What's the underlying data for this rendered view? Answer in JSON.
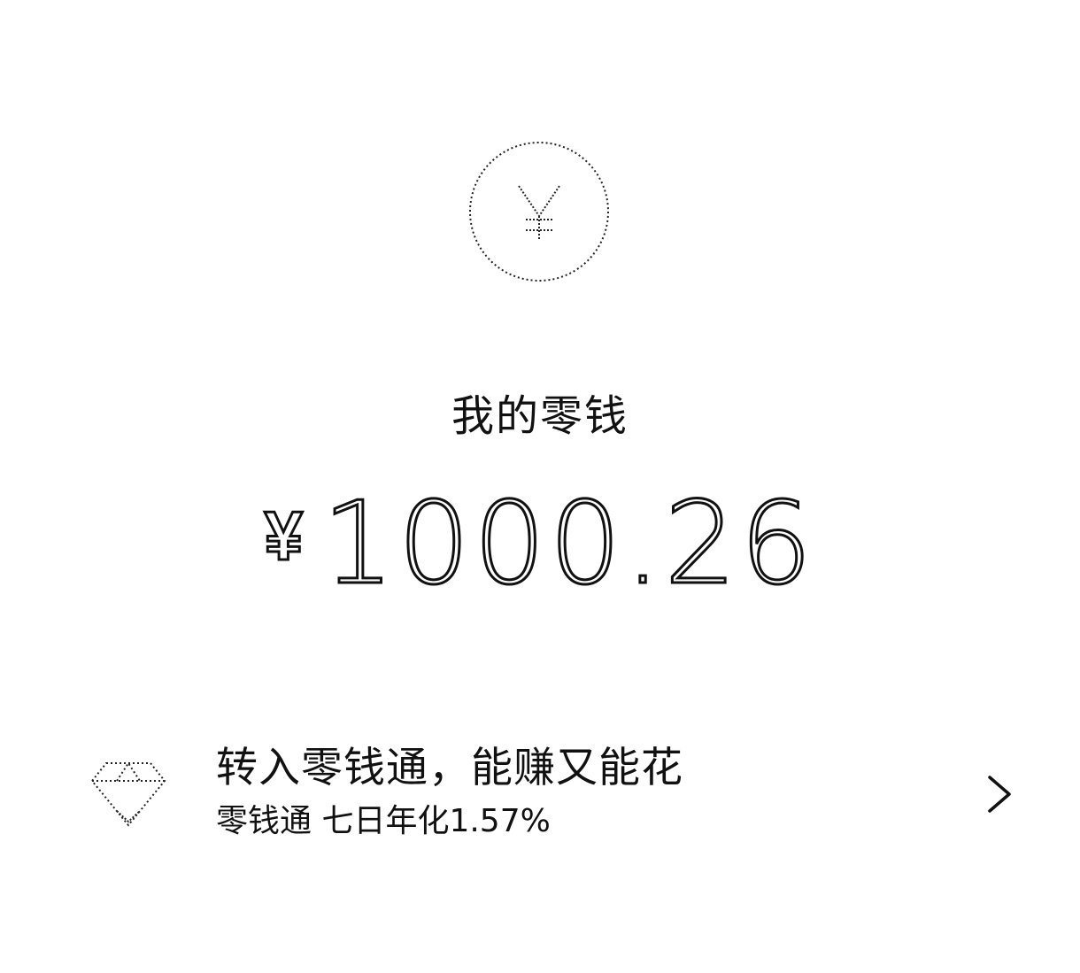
{
  "header": {
    "icon": "yuan-coin-icon",
    "title": "我的零钱"
  },
  "balance": {
    "currency": "¥",
    "amount": "1000.26"
  },
  "promo": {
    "icon": "diamond-icon",
    "title": "转入零钱通，能赚又能花",
    "subtitle": "零钱通 七日年化1.57%",
    "arrow_icon": "chevron-right-icon"
  },
  "colors": {
    "background": "#ffffff",
    "text": "#111111"
  }
}
